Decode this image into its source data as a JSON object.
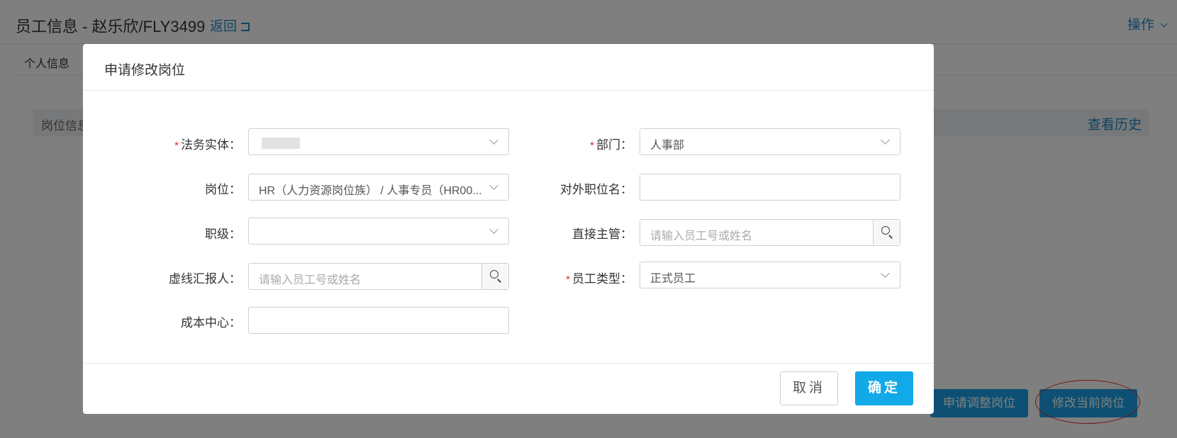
{
  "page": {
    "title": "员工信息 - 赵乐欣/FLY3499",
    "back_label": "返回",
    "ops_label": "操作",
    "tab_personal": "个人信息",
    "section_title": "岗位信息",
    "view_history": "查看历史",
    "apply_adjust_label": "申请调整岗位",
    "modify_current_label": "修改当前岗位"
  },
  "modal": {
    "title": "申请修改岗位",
    "fields": {
      "legal_entity": {
        "label": "法务实体：",
        "required": "*",
        "value": ""
      },
      "department": {
        "label": "部门：",
        "required": "*",
        "value": "人事部"
      },
      "position": {
        "label": "岗位：",
        "value": "HR（人力资源岗位族） / 人事专员（HR00..."
      },
      "external_title": {
        "label": "对外职位名：",
        "value": ""
      },
      "job_level": {
        "label": "职级：",
        "value": ""
      },
      "direct_supervisor": {
        "label": "直接主管：",
        "placeholder": "请输入员工号或姓名"
      },
      "dotted_line_reporter": {
        "label": "虚线汇报人：",
        "placeholder": "请输入员工号或姓名"
      },
      "employee_type": {
        "label": "员工类型：",
        "required": "*",
        "value": "正式员工"
      },
      "cost_center": {
        "label": "成本中心：",
        "value": ""
      }
    },
    "cancel_label": "取消",
    "ok_label": "确定"
  }
}
